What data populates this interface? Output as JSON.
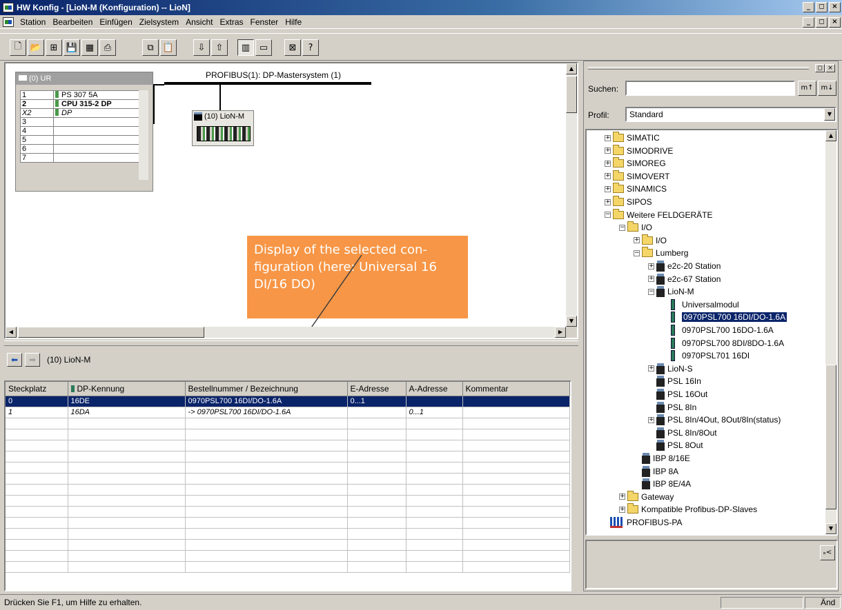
{
  "window": {
    "title": "HW Konfig - [LioN-M (Konfiguration) -- LioN]",
    "controls": [
      "_",
      "◻",
      "×"
    ]
  },
  "menu": [
    "Station",
    "Bearbeiten",
    "Einfügen",
    "Zielsystem",
    "Ansicht",
    "Extras",
    "Fenster",
    "Hilfe"
  ],
  "rack": {
    "title": "(0) UR",
    "rows": [
      {
        "slot": "1",
        "module": "PS 307 5A",
        "bold": false
      },
      {
        "slot": "2",
        "module": "CPU 315-2 DP",
        "bold": true
      },
      {
        "slot": "X2",
        "module": "DP",
        "bold": false
      },
      {
        "slot": "3",
        "module": "",
        "bold": false
      },
      {
        "slot": "4",
        "module": "",
        "bold": false
      },
      {
        "slot": "5",
        "module": "",
        "bold": false
      },
      {
        "slot": "6",
        "module": "",
        "bold": false
      },
      {
        "slot": "7",
        "module": "",
        "bold": false
      }
    ]
  },
  "profibus": {
    "label": "PROFIBUS(1): DP-Mastersystem (1)",
    "slave_label": "(10) LioN-M"
  },
  "callout": {
    "text": "Display of the selected con-figuration (here: Universal 16 DI/16 DO)"
  },
  "detail": {
    "station": "(10)  LioN-M",
    "columns": [
      "Steckplatz",
      "DP-Kennung",
      "Bestellnummer / Bezeichnung",
      "E-Adresse",
      "A-Adresse",
      "Kommentar"
    ],
    "rows": [
      {
        "slot": "0",
        "dp": "16DE",
        "order": "0970PSL700 16DI/DO-1.6A",
        "e": "0...1",
        "a": "",
        "comment": "",
        "selected": true,
        "italic": false
      },
      {
        "slot": "1",
        "dp": "16DA",
        "order": "-> 0970PSL700 16DI/DO-1.6A",
        "e": "",
        "a": "0...1",
        "comment": "",
        "selected": false,
        "italic": true
      }
    ]
  },
  "catalog": {
    "search_label": "Suchen:",
    "search_value": "",
    "search_btn1": "m↑",
    "search_btn2": "m↓",
    "profile_label": "Profil:",
    "profile_value": "Standard",
    "tree": [
      {
        "label": "SIMATIC",
        "indent": 0,
        "exp": "+",
        "icon": "folder"
      },
      {
        "label": "SIMODRIVE",
        "indent": 0,
        "exp": "+",
        "icon": "folder"
      },
      {
        "label": "SIMOREG",
        "indent": 0,
        "exp": "+",
        "icon": "folder"
      },
      {
        "label": "SIMOVERT",
        "indent": 0,
        "exp": "+",
        "icon": "folder"
      },
      {
        "label": "SINAMICS",
        "indent": 0,
        "exp": "+",
        "icon": "folder"
      },
      {
        "label": "SIPOS",
        "indent": 0,
        "exp": "+",
        "icon": "folder"
      },
      {
        "label": "Weitere FELDGERÄTE",
        "indent": 0,
        "exp": "-",
        "icon": "folder"
      },
      {
        "label": "I/O",
        "indent": 1,
        "exp": "-",
        "icon": "folder"
      },
      {
        "label": "I/O",
        "indent": 2,
        "exp": "+",
        "icon": "folder"
      },
      {
        "label": "Lumberg",
        "indent": 2,
        "exp": "-",
        "icon": "folder"
      },
      {
        "label": "e2c-20 Station",
        "indent": 3,
        "exp": "+",
        "icon": "station"
      },
      {
        "label": "e2c-67 Station",
        "indent": 3,
        "exp": "+",
        "icon": "station"
      },
      {
        "label": "LioN-M",
        "indent": 3,
        "exp": "-",
        "icon": "station"
      },
      {
        "label": "Universalmodul",
        "indent": 4,
        "exp": "",
        "icon": "module"
      },
      {
        "label": "0970PSL700 16DI/DO-1.6A",
        "indent": 4,
        "exp": "",
        "icon": "module",
        "selected": true
      },
      {
        "label": "0970PSL700 16DO-1.6A",
        "indent": 4,
        "exp": "",
        "icon": "module"
      },
      {
        "label": "0970PSL700 8DI/8DO-1.6A",
        "indent": 4,
        "exp": "",
        "icon": "module"
      },
      {
        "label": "0970PSL701 16DI",
        "indent": 4,
        "exp": "",
        "icon": "module"
      },
      {
        "label": "LioN-S",
        "indent": 3,
        "exp": "+",
        "icon": "station"
      },
      {
        "label": "PSL 16In",
        "indent": 3,
        "exp": "",
        "icon": "station"
      },
      {
        "label": "PSL 16Out",
        "indent": 3,
        "exp": "",
        "icon": "station"
      },
      {
        "label": "PSL 8In",
        "indent": 3,
        "exp": "",
        "icon": "station"
      },
      {
        "label": "PSL 8In/4Out, 8Out/8In(status)",
        "indent": 3,
        "exp": "+",
        "icon": "station"
      },
      {
        "label": "PSL 8In/8Out",
        "indent": 3,
        "exp": "",
        "icon": "station"
      },
      {
        "label": "PSL 8Out",
        "indent": 3,
        "exp": "",
        "icon": "station"
      },
      {
        "label": "IBP 8/16E",
        "indent": 2,
        "exp": "",
        "icon": "station"
      },
      {
        "label": "IBP 8A",
        "indent": 2,
        "exp": "",
        "icon": "station"
      },
      {
        "label": "IBP 8E/4A",
        "indent": 2,
        "exp": "",
        "icon": "station"
      },
      {
        "label": "Gateway",
        "indent": 1,
        "exp": "+",
        "icon": "folder"
      },
      {
        "label": "Kompatible Profibus-DP-Slaves",
        "indent": 1,
        "exp": "+",
        "icon": "folder"
      },
      {
        "label": "PROFIBUS-PA",
        "indent": -1,
        "exp": "",
        "icon": "bus"
      }
    ]
  },
  "status": {
    "text": "Drücken Sie F1, um Hilfe zu erhalten.",
    "mode": "Änd"
  }
}
